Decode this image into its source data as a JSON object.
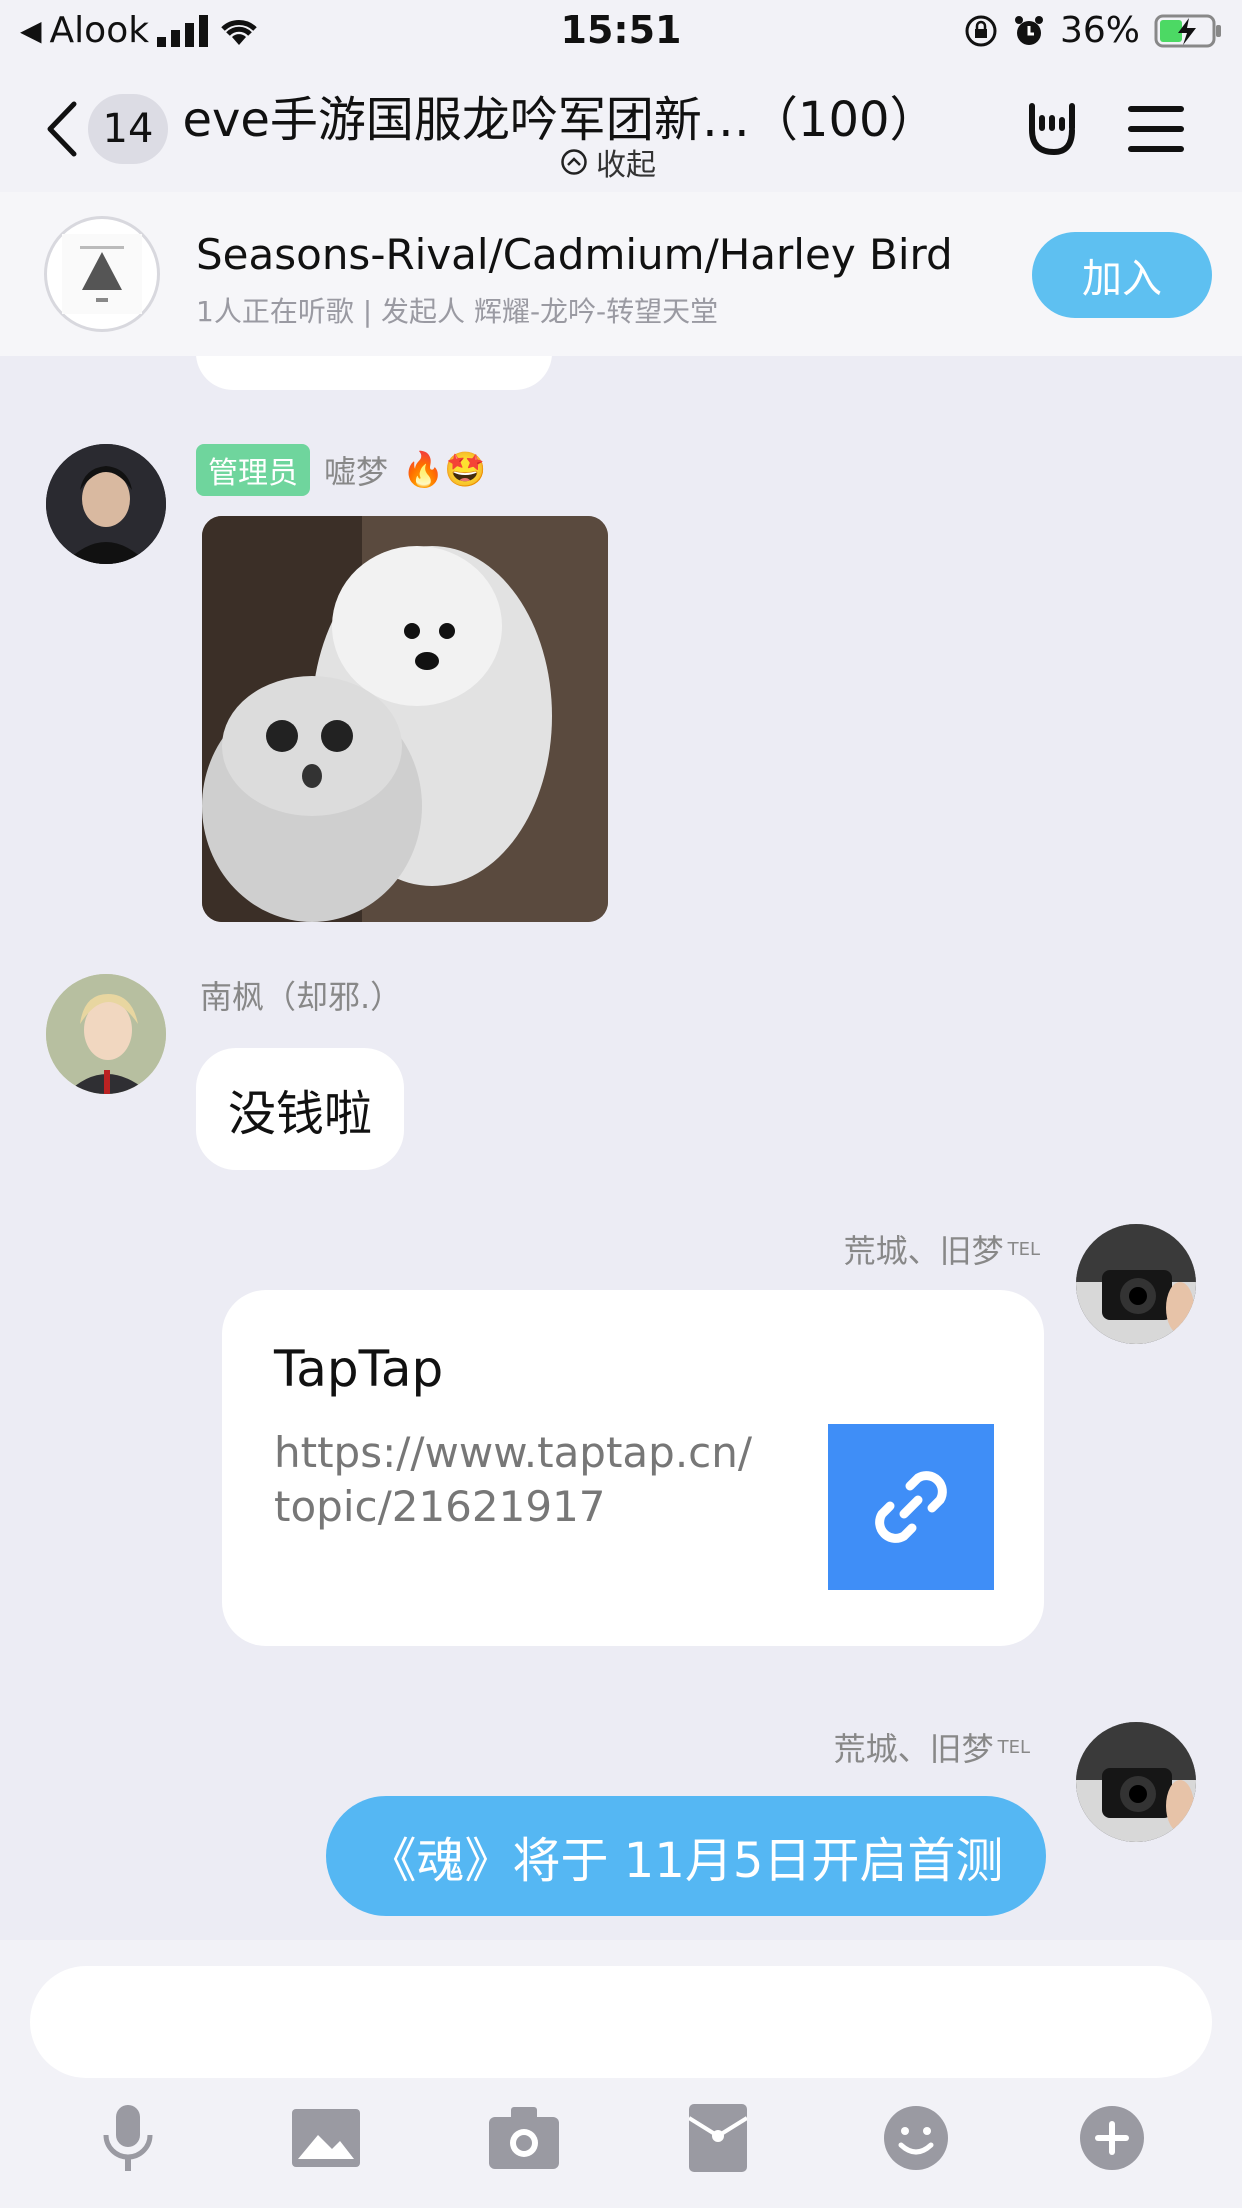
{
  "status": {
    "carrier": "Alook",
    "time": "15:51",
    "battery": "36%"
  },
  "header": {
    "back_count": "14",
    "title": "eve手游国服龙吟军团新…（100）",
    "collapse_label": "收起"
  },
  "music": {
    "song": "Seasons-Rival/Cadmium/Harley Bird",
    "subtitle": "1人正在听歌 | 发起人 辉耀-龙吟-转望天堂",
    "join_label": "加入"
  },
  "messages": {
    "m1": {
      "badge": "管理员",
      "sender": "嘘梦",
      "emoji": "🔥🤩"
    },
    "m2": {
      "sender": "南枫（却邪.）",
      "text": "没钱啦"
    },
    "m3": {
      "sender": "荒城、旧梦",
      "tag": "TEL",
      "card_title": "TapTap",
      "card_url": "https://www.taptap.cn/topic/21621917"
    },
    "m4": {
      "sender": "荒城、旧梦",
      "tag": "TEL",
      "text": "《魂》将于 11月5日开启首测"
    }
  },
  "input": {
    "placeholder": ""
  },
  "colors": {
    "accent": "#55b7f3",
    "join": "#5ec0f1",
    "admin_badge": "#6fd59d",
    "link_thumb": "#3f8ef7"
  },
  "icons": [
    "microphone-icon",
    "image-icon",
    "camera-icon",
    "red-packet-icon",
    "emoji-icon",
    "plus-icon"
  ]
}
